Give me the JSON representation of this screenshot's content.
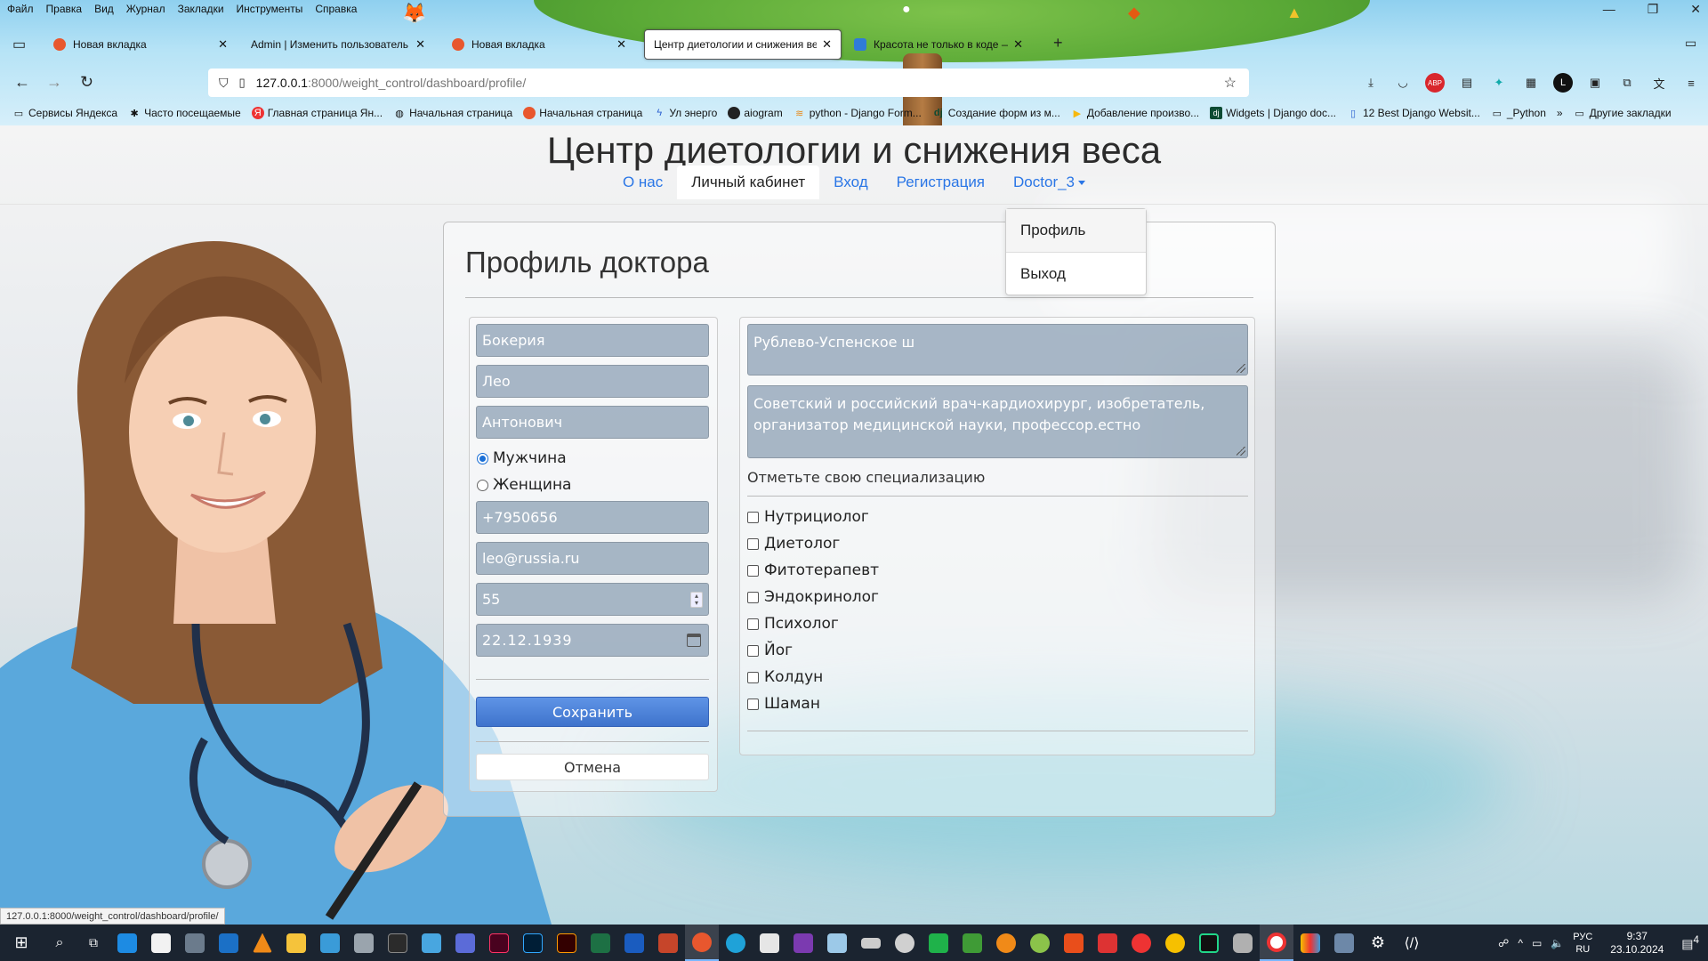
{
  "browser": {
    "menu": [
      "Файл",
      "Правка",
      "Вид",
      "Журнал",
      "Закладки",
      "Инструменты",
      "Справка"
    ],
    "tabs": [
      {
        "title": "Новая вкладка",
        "favicon_color": "#e8572e",
        "active": false
      },
      {
        "title": "Admin | Изменить пользователь | А",
        "favicon_color": "",
        "active": false
      },
      {
        "title": "Новая вкладка",
        "favicon_color": "#e8572e",
        "active": false
      },
      {
        "title": "Центр диетологии и снижения вес",
        "favicon_color": "",
        "active": true
      },
      {
        "title": "Красота не только в коде —",
        "favicon_color": "#2f7bd8",
        "active": false
      }
    ],
    "url_host": "127.0.0.1",
    "url_rest": ":8000/weight_control/dashboard/profile/",
    "bookmarks": [
      {
        "label": "Сервисы Яндекса",
        "icon": "folder-icon"
      },
      {
        "label": "Часто посещаемые",
        "icon": "gear-icon"
      },
      {
        "label": "Главная страница Ян...",
        "icon": "yandex-icon"
      },
      {
        "label": "Начальная страница",
        "icon": "globe-icon"
      },
      {
        "label": "Начальная страница",
        "icon": "firefox-icon"
      },
      {
        "label": "Ул энерго",
        "icon": "bolt-icon"
      },
      {
        "label": "aiogram",
        "icon": "aiogram-icon"
      },
      {
        "label": "python - Django Form...",
        "icon": "stack-icon"
      },
      {
        "label": "Создание форм из м...",
        "icon": "django-icon"
      },
      {
        "label": "Добавление произво...",
        "icon": "play-icon"
      },
      {
        "label": "Widgets | Django doc...",
        "icon": "django-icon"
      },
      {
        "label": "12 Best Django Websit...",
        "icon": "page-icon"
      },
      {
        "label": "_Python",
        "icon": "folder-icon"
      },
      {
        "label": "Другие закладки",
        "icon": "folder-icon"
      }
    ],
    "status_url": "127.0.0.1:8000/weight_control/dashboard/profile/"
  },
  "site": {
    "title": "Центр диетологии и снижения веса",
    "nav": {
      "about": "О нас",
      "cabinet": "Личный кабинет",
      "login": "Вход",
      "register": "Регистрация",
      "user": "Doctor_3"
    },
    "dropdown": {
      "profile": "Профиль",
      "logout": "Выход"
    }
  },
  "profile_form": {
    "title": "Профиль доктора",
    "last_name": "Бокерия",
    "first_name": "Лео",
    "patronymic": "Антонович",
    "gender_male": "Мужчина",
    "gender_female": "Женщина",
    "gender_selected": "Мужчина",
    "phone": "+7950656",
    "email": "leo@russia.ru",
    "age": "55",
    "birth_date": "22.12.1939",
    "address": "Рублево-Успенское ш",
    "about": "Советский и российский врач-кардиохирург, изобретатель, организатор медицинской науки, профессор.естно",
    "specialization_label": "Отметьте свою специализацию",
    "specializations": [
      "Нутрициолог",
      "Диетолог",
      "Фитотерапевт",
      "Эндокринолог",
      "Психолог",
      "Йог",
      "Колдун",
      "Шаман"
    ],
    "save": "Сохранить",
    "cancel": "Отмена"
  },
  "taskbar": {
    "lang_top": "РУС",
    "lang_bottom": "RU",
    "time": "9:37",
    "date": "23.10.2024",
    "notifications": "4"
  }
}
